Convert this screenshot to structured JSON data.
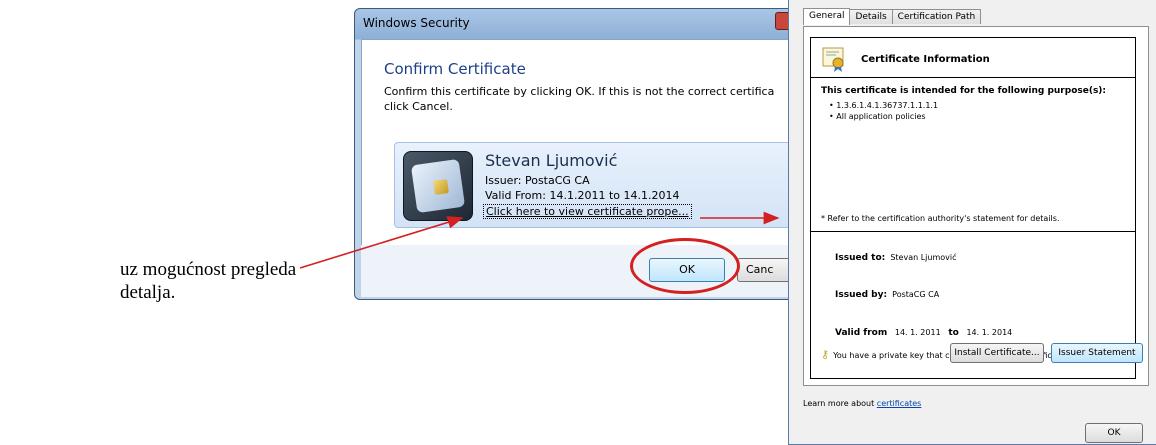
{
  "caption": {
    "line1": "uz mogućnost pregleda",
    "line2": "detalja."
  },
  "security_dialog": {
    "title": "Windows Security",
    "heading": "Confirm Certificate",
    "description_line1": "Confirm this certificate by clicking OK. If this is not the correct certifica",
    "description_line2": "click Cancel.",
    "certificate": {
      "name": "Stevan Ljumović",
      "issuer": "Issuer: PostaCG CA",
      "valid": "Valid From: 14.1.2011 to 14.1.2014",
      "link": "Click here to view certificate prope..."
    },
    "ok_label": "OK",
    "cancel_label": "Canc"
  },
  "certificate_window": {
    "tabs": [
      "General",
      "Details",
      "Certification Path"
    ],
    "info_title": "Certificate Information",
    "purpose_heading": "This certificate is intended for the following purpose(s):",
    "purposes": [
      "1.3.6.1.4.1.36737.1.1.1.1",
      "All application policies"
    ],
    "refer_note": "* Refer to the certification authority's statement for details.",
    "issued_to_label": "Issued to:",
    "issued_to_value": "Stevan Ljumović",
    "issued_by_label": "Issued by:",
    "issued_by_value": "PostaCG CA",
    "valid_from_label": "Valid from",
    "valid_from_value": "14. 1. 2011",
    "valid_to_label": "to",
    "valid_to_value": "14. 1. 2014",
    "private_key_note": "You have a private key that corresponds to this certificate.",
    "install_button": "Install Certificate...",
    "issuer_statement_button": "Issuer Statement",
    "learn_more_prefix": "Learn more about ",
    "learn_more_link": "certificates",
    "ok_label": "OK"
  },
  "colors": {
    "annotation_red": "#d42020",
    "heading_blue": "#1e3f8a"
  }
}
